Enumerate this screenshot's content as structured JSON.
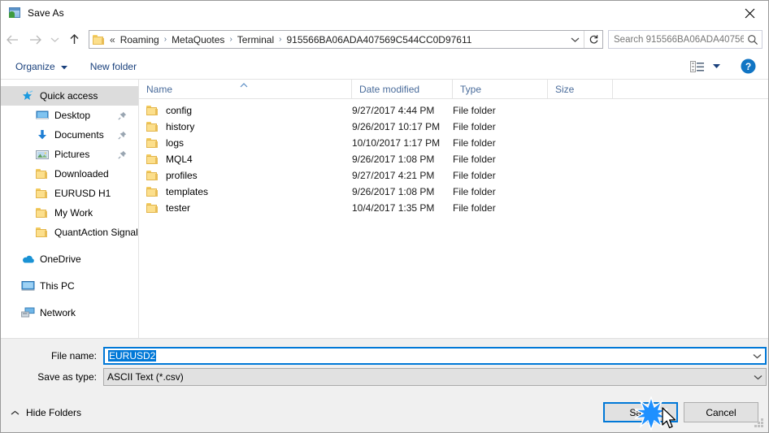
{
  "window": {
    "title": "Save As",
    "title_icon": "save-as-app-icon",
    "close_icon": "close-icon"
  },
  "nav": {
    "back_icon": "back-arrow-icon",
    "forward_icon": "forward-arrow-icon",
    "recent_icon": "recent-locations-chevron-icon",
    "up_icon": "up-arrow-icon",
    "breadcrumb_folder_icon": "folder-icon",
    "breadcrumb_overflow": "«",
    "breadcrumbs": [
      "Roaming",
      "MetaQuotes",
      "Terminal",
      "915566BA06ADA407569C544CC0D97611"
    ],
    "separator": "›",
    "dropdown_icon": "chevron-down-icon",
    "refresh_icon": "refresh-icon"
  },
  "search": {
    "placeholder": "Search 915566BA06ADA40756...",
    "value": "",
    "icon": "search-icon"
  },
  "toolbar": {
    "organize_label": "Organize",
    "organize_caret_icon": "caret-down-icon",
    "new_folder_label": "New folder",
    "view_icon": "view-layout-icon",
    "view_caret_icon": "caret-down-icon",
    "help_icon": "help-question-icon",
    "help_label": "?"
  },
  "sidebar": {
    "items": [
      {
        "label": "Quick access",
        "icon": "star-pin-icon",
        "indent": 0,
        "selected": true,
        "pinned": false
      },
      {
        "label": "Desktop",
        "icon": "desktop-monitor-icon",
        "indent": 1,
        "selected": false,
        "pinned": true
      },
      {
        "label": "Documents",
        "icon": "documents-download-icon",
        "indent": 1,
        "selected": false,
        "pinned": true
      },
      {
        "label": "Pictures",
        "icon": "pictures-icon",
        "indent": 1,
        "selected": false,
        "pinned": true
      },
      {
        "label": "Downloaded",
        "icon": "folder-icon",
        "indent": 1,
        "selected": false,
        "pinned": false
      },
      {
        "label": "EURUSD H1",
        "icon": "folder-icon",
        "indent": 1,
        "selected": false,
        "pinned": false
      },
      {
        "label": "My Work",
        "icon": "folder-icon",
        "indent": 1,
        "selected": false,
        "pinned": false
      },
      {
        "label": "QuantAction Signal",
        "icon": "folder-icon",
        "indent": 1,
        "selected": false,
        "pinned": false
      },
      {
        "label": "OneDrive",
        "icon": "onedrive-cloud-icon",
        "indent": 0,
        "selected": false,
        "pinned": false,
        "gap_before": true
      },
      {
        "label": "This PC",
        "icon": "this-pc-monitor-icon",
        "indent": 0,
        "selected": false,
        "pinned": false,
        "gap_before": true
      },
      {
        "label": "Network",
        "icon": "network-icon",
        "indent": 0,
        "selected": false,
        "pinned": false,
        "gap_before": true
      }
    ],
    "pin_icon": "pin-icon"
  },
  "filelist": {
    "columns": [
      "Name",
      "Date modified",
      "Type",
      "Size"
    ],
    "sort_column": "Name",
    "sort_icon": "sort-ascending-caret-icon",
    "rows": [
      {
        "name": "config",
        "date": "9/27/2017 4:44 PM",
        "type": "File folder",
        "size": "",
        "icon": "folder-icon"
      },
      {
        "name": "history",
        "date": "9/26/2017 10:17 PM",
        "type": "File folder",
        "size": "",
        "icon": "folder-icon"
      },
      {
        "name": "logs",
        "date": "10/10/2017 1:17 PM",
        "type": "File folder",
        "size": "",
        "icon": "folder-icon"
      },
      {
        "name": "MQL4",
        "date": "9/26/2017 1:08 PM",
        "type": "File folder",
        "size": "",
        "icon": "folder-icon"
      },
      {
        "name": "profiles",
        "date": "9/27/2017 4:21 PM",
        "type": "File folder",
        "size": "",
        "icon": "folder-icon"
      },
      {
        "name": "templates",
        "date": "9/26/2017 1:08 PM",
        "type": "File folder",
        "size": "",
        "icon": "folder-icon"
      },
      {
        "name": "tester",
        "date": "10/4/2017 1:35 PM",
        "type": "File folder",
        "size": "",
        "icon": "folder-icon"
      }
    ]
  },
  "form": {
    "filename_label": "File name:",
    "filename_value": "EURUSD2",
    "filetype_label": "Save as type:",
    "filetype_value": "ASCII Text (*.csv)",
    "dropdown_icon": "chevron-down-icon"
  },
  "footer": {
    "hide_folders_label": "Hide Folders",
    "hide_folders_icon": "caret-up-icon",
    "save_label": "Save",
    "cancel_label": "Cancel",
    "resize_grip_icon": "resize-grip-icon",
    "cursor_icon": "mouse-pointer-icon",
    "click_burst_icon": "click-burst-icon"
  },
  "colors": {
    "accent": "#0078d7",
    "selection": "#0078d7",
    "folder": "#fcdf8c",
    "header_text": "#4a6c9b",
    "toolbar_text": "#19407c"
  }
}
